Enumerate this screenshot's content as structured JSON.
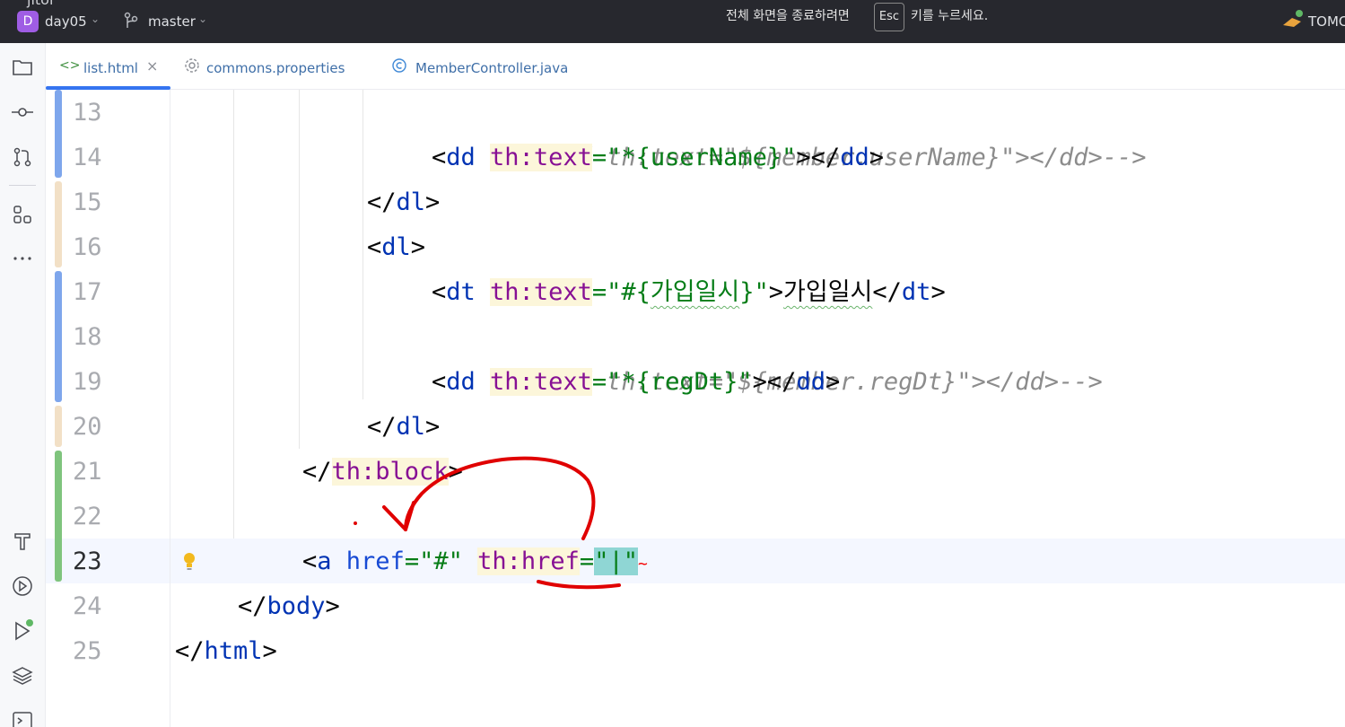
{
  "titlebar": {
    "logo_partial": "jitoi",
    "project_badge": "D",
    "project_name": "day05",
    "branch_name": "master",
    "fullscreen_msg_pre": "전체 화면을 종료하려면",
    "fullscreen_key": "Esc",
    "fullscreen_msg_post": "키를 누르세요.",
    "run_config": "TOMC"
  },
  "tabs": [
    {
      "label": "list.html",
      "icon": "html-file-icon",
      "active": true,
      "close": "×"
    },
    {
      "label": "commons.properties",
      "icon": "gear-icon",
      "active": false
    },
    {
      "label": "MemberController.java",
      "icon": "java-class-icon",
      "active": false
    }
  ],
  "editor": {
    "current_line": 23,
    "lines": [
      {
        "n": "13",
        "text": "<!--<dd th:text=\"${member.userName}\"></dd>-->"
      },
      {
        "n": "14",
        "text": "<dd th:text=\"*{userName}\"></dd>"
      },
      {
        "n": "15",
        "text": "</dl>"
      },
      {
        "n": "16",
        "text": "<dl>"
      },
      {
        "n": "17",
        "text": "<dt th:text=\"#{가입일시}\">가입일시</dt>"
      },
      {
        "n": "18",
        "text": "<!--<dd th:text=\"${member.regDt}\"></dd>-->"
      },
      {
        "n": "19",
        "text": "<dd th:text=\"*{regDt}\"></dd>"
      },
      {
        "n": "20",
        "text": "</dl>"
      },
      {
        "n": "21",
        "text": "</th:block>"
      },
      {
        "n": "22",
        "text": ""
      },
      {
        "n": "23",
        "text": "<a href=\"#\" th:href=\"\""
      },
      {
        "n": "24",
        "text": "</body>"
      },
      {
        "n": "25",
        "text": "</html>"
      }
    ]
  },
  "colors": {
    "tag": "#0033b3",
    "attr": "#871094",
    "string": "#067d17",
    "comment": "#8c8c8c",
    "change_modified": "#7ea6ec",
    "change_added": "#7fc47d",
    "change_other": "#f2e0c6",
    "annotation": "#e00000"
  },
  "toolstrip": [
    "folder-icon",
    "commit-icon",
    "pull-requests-icon",
    "structure-icon",
    "more-icon",
    "build-icon",
    "services-icon",
    "run-icon",
    "layers-icon",
    "terminal-icon"
  ]
}
